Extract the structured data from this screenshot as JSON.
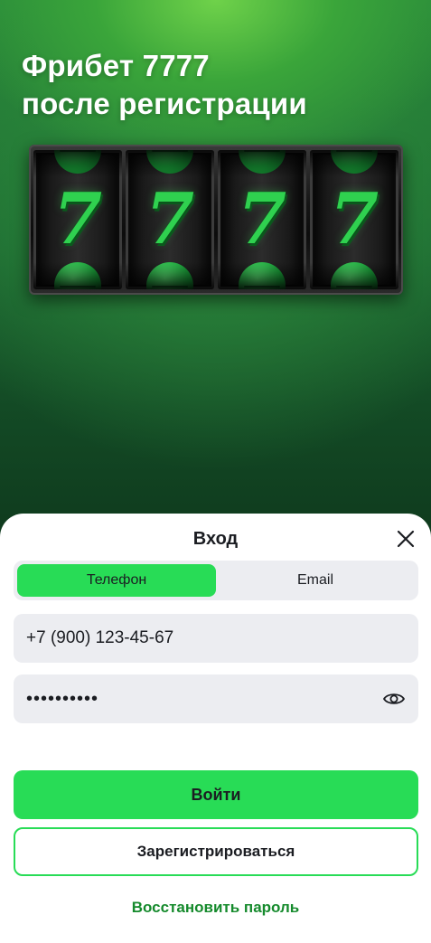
{
  "hero": {
    "title_line1": "Фрибет 7777",
    "title_line2": "после регистрации",
    "reels": [
      "7",
      "7",
      "7",
      "7"
    ]
  },
  "login": {
    "title": "Вход",
    "tabs": [
      {
        "label": "Телефон",
        "active": true
      },
      {
        "label": "Email",
        "active": false
      }
    ],
    "phone_value": "+7 (900) 123-45-67",
    "password_value": "••••••••••",
    "submit_label": "Войти",
    "register_label": "Зарегистрироваться",
    "recover_label": "Восстановить пароль"
  },
  "icons": {
    "close": "close-icon",
    "eye": "eye-icon"
  },
  "colors": {
    "accent": "#28dc56",
    "link": "#158a2c",
    "field_bg": "#ecedf1",
    "text": "#1b1d22"
  }
}
